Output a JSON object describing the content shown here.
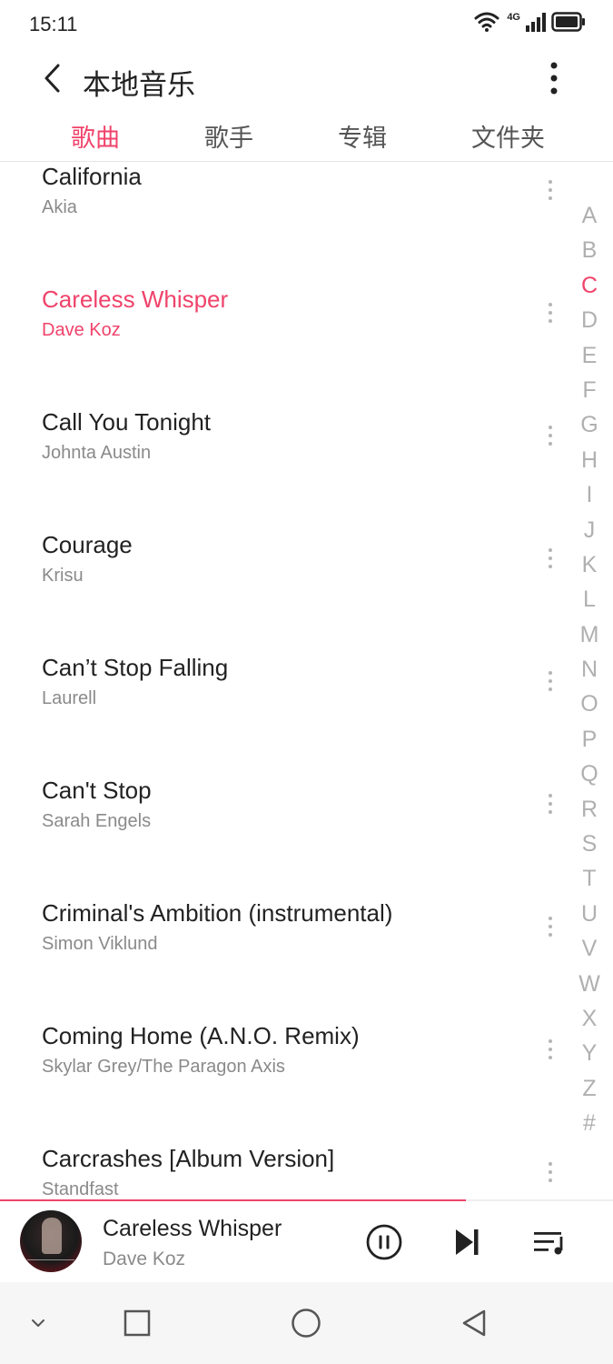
{
  "status_bar": {
    "time": "15:11",
    "network_label": "4G",
    "icons": [
      "wifi-icon",
      "signal-icon",
      "battery-icon"
    ]
  },
  "header": {
    "title": "本地音乐",
    "back_icon": "chevron-left-icon",
    "more_icon": "more-vertical-icon"
  },
  "tabs": [
    {
      "label": "歌曲",
      "active": true
    },
    {
      "label": "歌手",
      "active": false
    },
    {
      "label": "专辑",
      "active": false
    },
    {
      "label": "文件夹",
      "active": false
    }
  ],
  "songs": [
    {
      "title": "California",
      "artist": "Akia",
      "active": false
    },
    {
      "title": "Careless Whisper",
      "artist": "Dave Koz",
      "active": true
    },
    {
      "title": "Call You Tonight",
      "artist": "Johnta Austin",
      "active": false
    },
    {
      "title": "Courage",
      "artist": "Krisu",
      "active": false
    },
    {
      "title": "Can’t Stop Falling",
      "artist": "Laurell",
      "active": false
    },
    {
      "title": "Can't Stop",
      "artist": "Sarah Engels",
      "active": false
    },
    {
      "title": "Criminal's Ambition (instrumental)",
      "artist": "Simon Viklund",
      "active": false
    },
    {
      "title": "Coming Home (A.N.O. Remix)",
      "artist": "Skylar Grey/The Paragon Axis",
      "active": false
    },
    {
      "title": "Carcrashes [Album Version]",
      "artist": "Standfast",
      "active": false
    }
  ],
  "alpha_index": {
    "letters": [
      "A",
      "B",
      "C",
      "D",
      "E",
      "F",
      "G",
      "H",
      "I",
      "J",
      "K",
      "L",
      "M",
      "N",
      "O",
      "P",
      "Q",
      "R",
      "S",
      "T",
      "U",
      "V",
      "W",
      "X",
      "Y",
      "Z",
      "#"
    ],
    "active": "C"
  },
  "now_playing": {
    "title": "Careless Whisper",
    "artist": "Dave Koz",
    "progress": 0.76,
    "icons": [
      "album-art",
      "pause-icon",
      "skip-next-icon",
      "playlist-icon"
    ]
  },
  "nav_bar": {
    "icons": [
      "chevron-down-icon",
      "square-icon",
      "circle-icon",
      "triangle-back-icon"
    ]
  },
  "colors": {
    "accent": "#f0436b",
    "text_primary": "#222222",
    "text_secondary": "#8a8a8a",
    "index_inactive": "#b0b0b0",
    "nav_background": "#f6f6f6"
  }
}
